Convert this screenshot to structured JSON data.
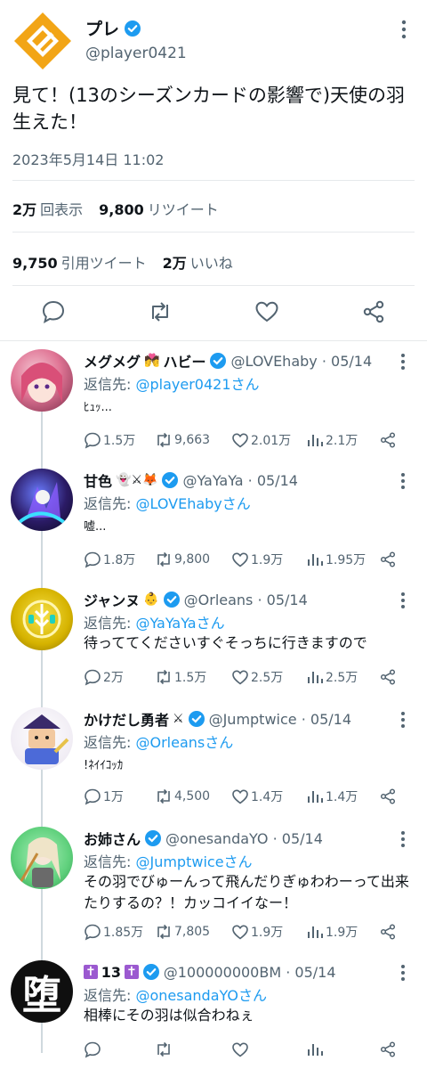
{
  "main_tweet": {
    "display_name": "プレ",
    "handle": "@player0421",
    "text": "見て！(13のシーズンカードの影響で)天使の羽生えた！",
    "timestamp": "2023年5月14日 11:02",
    "views": {
      "value": "2万",
      "label": "回表示"
    },
    "retweets": {
      "value": "9,800",
      "label": "リツイート"
    },
    "quotes": {
      "value": "9,750",
      "label": "引用ツイート"
    },
    "likes": {
      "value": "2万",
      "label": "いいね"
    }
  },
  "replies": [
    {
      "name": "メグメグ",
      "name_suffix": "ハビー",
      "name_emoji": "💏",
      "handle_date": "@LOVEhaby · 05/14",
      "reply_prefix": "返信先: ",
      "reply_to": "@player0421さん",
      "text": "ﾋｭｯ...",
      "stats": {
        "replies": "1.5万",
        "retweets": "9,663",
        "likes": "2.01万",
        "views": "2.1万"
      }
    },
    {
      "name": "甘色",
      "name_suffix": "",
      "name_emoji": "👻⚔🦊",
      "handle_date": "@YaYaYa · 05/14",
      "reply_prefix": "返信先: ",
      "reply_to": "@LOVEhabyさん",
      "text": "嘘...",
      "stats": {
        "replies": "1.8万",
        "retweets": "9,800",
        "likes": "1.9万",
        "views": "1.95万"
      }
    },
    {
      "name": "ジャンヌ",
      "name_suffix": "",
      "name_emoji": "👶",
      "handle_date": "@Orleans · 05/14",
      "reply_prefix": "返信先: ",
      "reply_to": "@YaYaYaさん",
      "text": "待っててくださいすぐそっちに行きますので",
      "stats": {
        "replies": "2万",
        "retweets": "1.5万",
        "likes": "2.5万",
        "views": "2.5万"
      }
    },
    {
      "name": "かけだし勇者",
      "name_suffix": "",
      "name_emoji": "⚔",
      "handle_date": "@Jumptwice · 05/14",
      "reply_prefix": "返信先: ",
      "reply_to": "@Orleansさん",
      "text": "!ﾈｲｲｺｯｶ",
      "stats": {
        "replies": "1万",
        "retweets": "4,500",
        "likes": "1.4万",
        "views": "1.4万"
      }
    },
    {
      "name": "お姉さん",
      "name_suffix": "",
      "name_emoji": "",
      "handle_date": "@onesandaYO · 05/14",
      "reply_prefix": "返信先: ",
      "reply_to": "@Jumptwiceさん",
      "text": "その羽でびゅーんって飛んだりぎゅわわーって出来たりするの？！カッコイイなー！",
      "stats": {
        "replies": "1.85万",
        "retweets": "7,805",
        "likes": "1.9万",
        "views": "1.9万"
      }
    },
    {
      "name": "13",
      "name_prefix_emoji": "✝",
      "name_suffix": "",
      "name_emoji": "✝",
      "handle_date": "@100000000BM · 05/14",
      "reply_prefix": "返信先: ",
      "reply_to": "@onesandaYOさん",
      "text": "相棒にその羽は似合わねぇ",
      "avatar_char": "堕",
      "stats": {
        "replies": "",
        "retweets": "",
        "likes": "",
        "views": ""
      }
    }
  ],
  "colors": {
    "accent": "#1d9bf0",
    "muted": "#536471",
    "logo_orange": "#f2a516"
  }
}
